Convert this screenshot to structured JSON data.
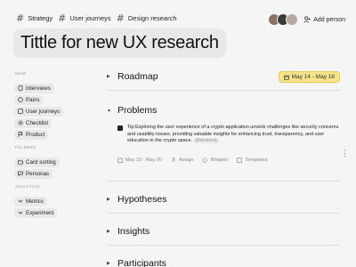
{
  "tags": [
    "Strategy",
    "User journeys",
    "Design research"
  ],
  "add_person_label": "Add person",
  "title": "Tittle for new UX research",
  "sidebar": {
    "main_label": "MAIN",
    "main_items": [
      {
        "label": "Interviews",
        "icon": "phone-icon"
      },
      {
        "label": "Pains",
        "icon": "face-icon"
      },
      {
        "label": "User journeys",
        "icon": "journey-icon"
      },
      {
        "label": "Checklist",
        "icon": "gear-icon"
      },
      {
        "label": "Product",
        "icon": "flag-icon"
      }
    ],
    "folders_label": "FOLDERS",
    "folder_items": [
      {
        "label": "Card sorting",
        "icon": "folder-icon"
      },
      {
        "label": "Personas",
        "icon": "chat-icon"
      }
    ],
    "analytics_label": "ANALYTICS",
    "analytics_items": [
      {
        "label": "Metrics",
        "icon": "chevron-down-icon"
      },
      {
        "label": "Experiment",
        "icon": "chevron-down-icon"
      }
    ]
  },
  "sections": {
    "roadmap": {
      "title": "Roadmap",
      "date": "May 14 - May 18"
    },
    "problems": {
      "title": "Problems",
      "tip": "Tip:Exploring the user experience of a crypto application unveils challenges like security concerns and usability issues, providing valuable insights for enhancing trust, transparency, and user education in the crypto space.",
      "mention": "@kimberly",
      "meta": {
        "date": "May 18 - May 20",
        "assign": "Assign",
        "widgets": "Widgets",
        "templates": "Templates"
      }
    },
    "hypotheses": {
      "title": "Hypotheses"
    },
    "insights": {
      "title": "Insights"
    },
    "participants": {
      "title": "Participants"
    }
  },
  "colors": {
    "date_pill": "#f7e48a",
    "background": "#f5f5f5"
  }
}
